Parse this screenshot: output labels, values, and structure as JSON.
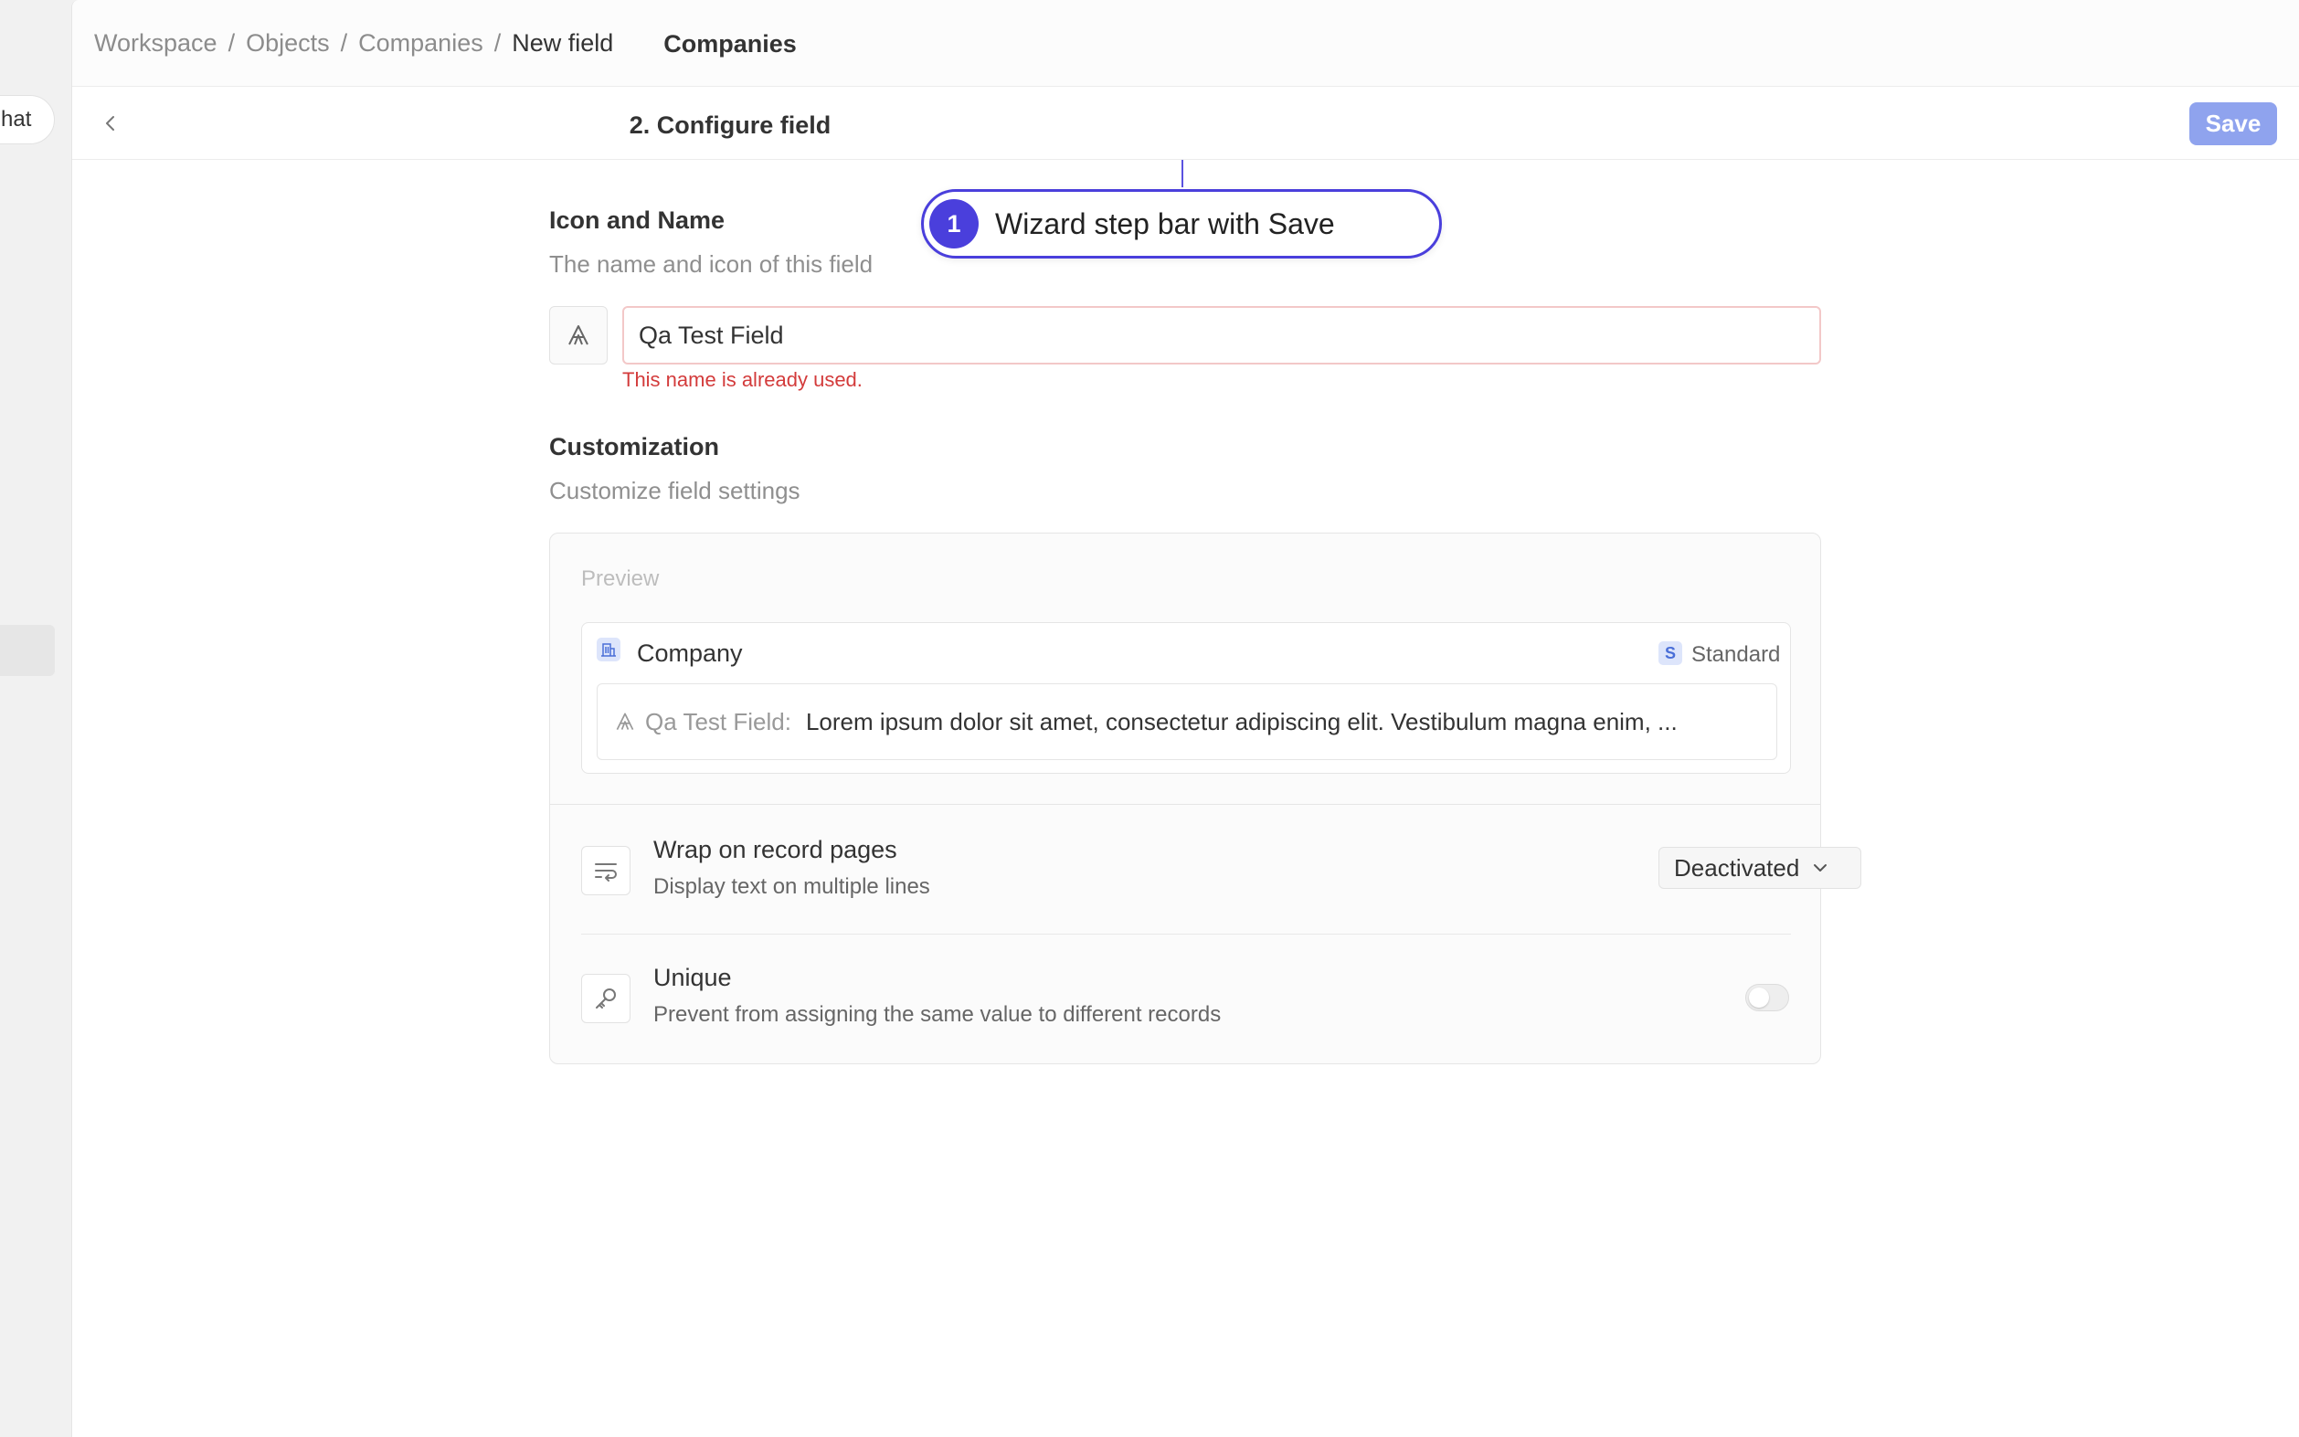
{
  "sidebar": {
    "chat_label": "hat"
  },
  "breadcrumb": {
    "items": [
      "Workspace",
      "Objects",
      "Companies"
    ],
    "separator": "/",
    "current": "New field"
  },
  "header": {
    "title": "Companies"
  },
  "stepbar": {
    "title": "2. Configure field",
    "save_label": "Save"
  },
  "callout": {
    "number": "1",
    "text": "Wizard step bar with Save"
  },
  "icon_name_section": {
    "title": "Icon and Name",
    "description": "The name and icon of this field",
    "icon": "text-a-icon",
    "name_value": "Qa Test Field",
    "error": "This name is already used."
  },
  "customization": {
    "title": "Customization",
    "description": "Customize field settings",
    "preview_label": "Preview",
    "preview": {
      "object_label": "Company",
      "badge_label": "Standard",
      "badge_letter": "S",
      "field_name": "Qa Test Field:",
      "field_value": "Lorem ipsum dolor sit amet, consectetur adipiscing elit. Vestibulum magna enim, ..."
    },
    "options": [
      {
        "title": "Wrap on record pages",
        "description": "Display text on multiple lines",
        "icon": "text-wrap-icon",
        "control": "dropdown",
        "value": "Deactivated"
      },
      {
        "title": "Unique",
        "description": "Prevent from assigning the same value to different records",
        "icon": "key-icon",
        "control": "toggle",
        "value": false
      }
    ]
  },
  "colors": {
    "accent": "#4a3fdc",
    "save_button": "#8fa3ee",
    "error": "#d33b3b",
    "error_border": "#f3c8c8"
  }
}
